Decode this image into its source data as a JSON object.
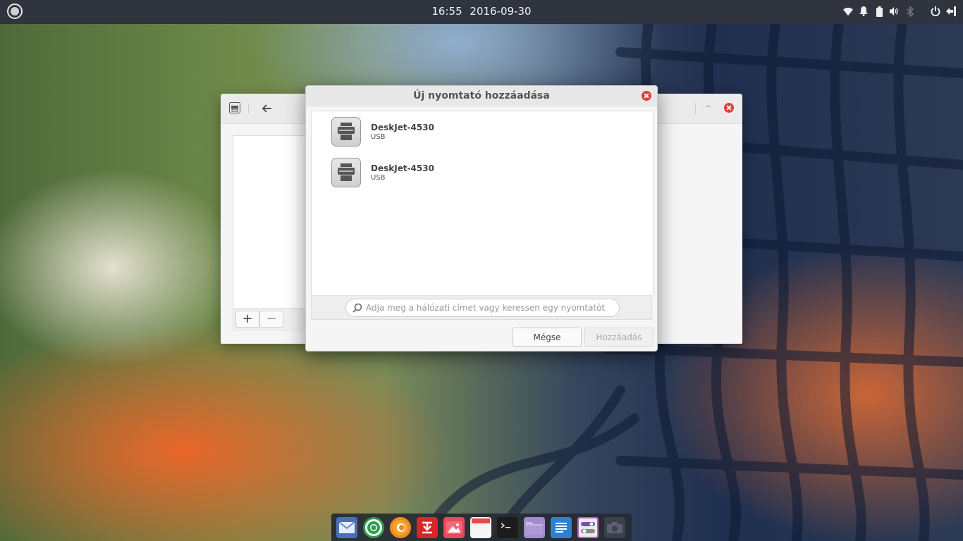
{
  "top_panel": {
    "time": "16:55",
    "date": "2016-09-30",
    "indicator_icons": [
      "wifi-icon",
      "bell-icon",
      "battery-icon",
      "volume-icon",
      "bluetooth-icon",
      "power-icon",
      "logout-icon"
    ]
  },
  "background_window": {
    "toolbar": {
      "add_label": "+",
      "remove_label": "−"
    },
    "minimize_label": "–"
  },
  "dialog": {
    "title": "Új nyomtató hozzáadása",
    "printers": [
      {
        "name": "DeskJet-4530",
        "connection": "USB"
      },
      {
        "name": "DeskJet-4530",
        "connection": "USB"
      }
    ],
    "search": {
      "placeholder": "Adja meg a hálózati címet vagy keressen egy nyomtatót",
      "value": ""
    },
    "cancel_label": "Mégse",
    "add_label": "Hozzáadás"
  },
  "dock": {
    "items": [
      "mail-icon",
      "chrome-icon",
      "firefox-icon",
      "software-center-icon",
      "photos-icon",
      "calendar-icon",
      "terminal-icon",
      "files-icon",
      "text-editor-icon",
      "settings-icon",
      "camera-icon"
    ]
  },
  "colors": {
    "panel": "#2f343f",
    "close": "#e0403a",
    "dock": "#262a32"
  }
}
